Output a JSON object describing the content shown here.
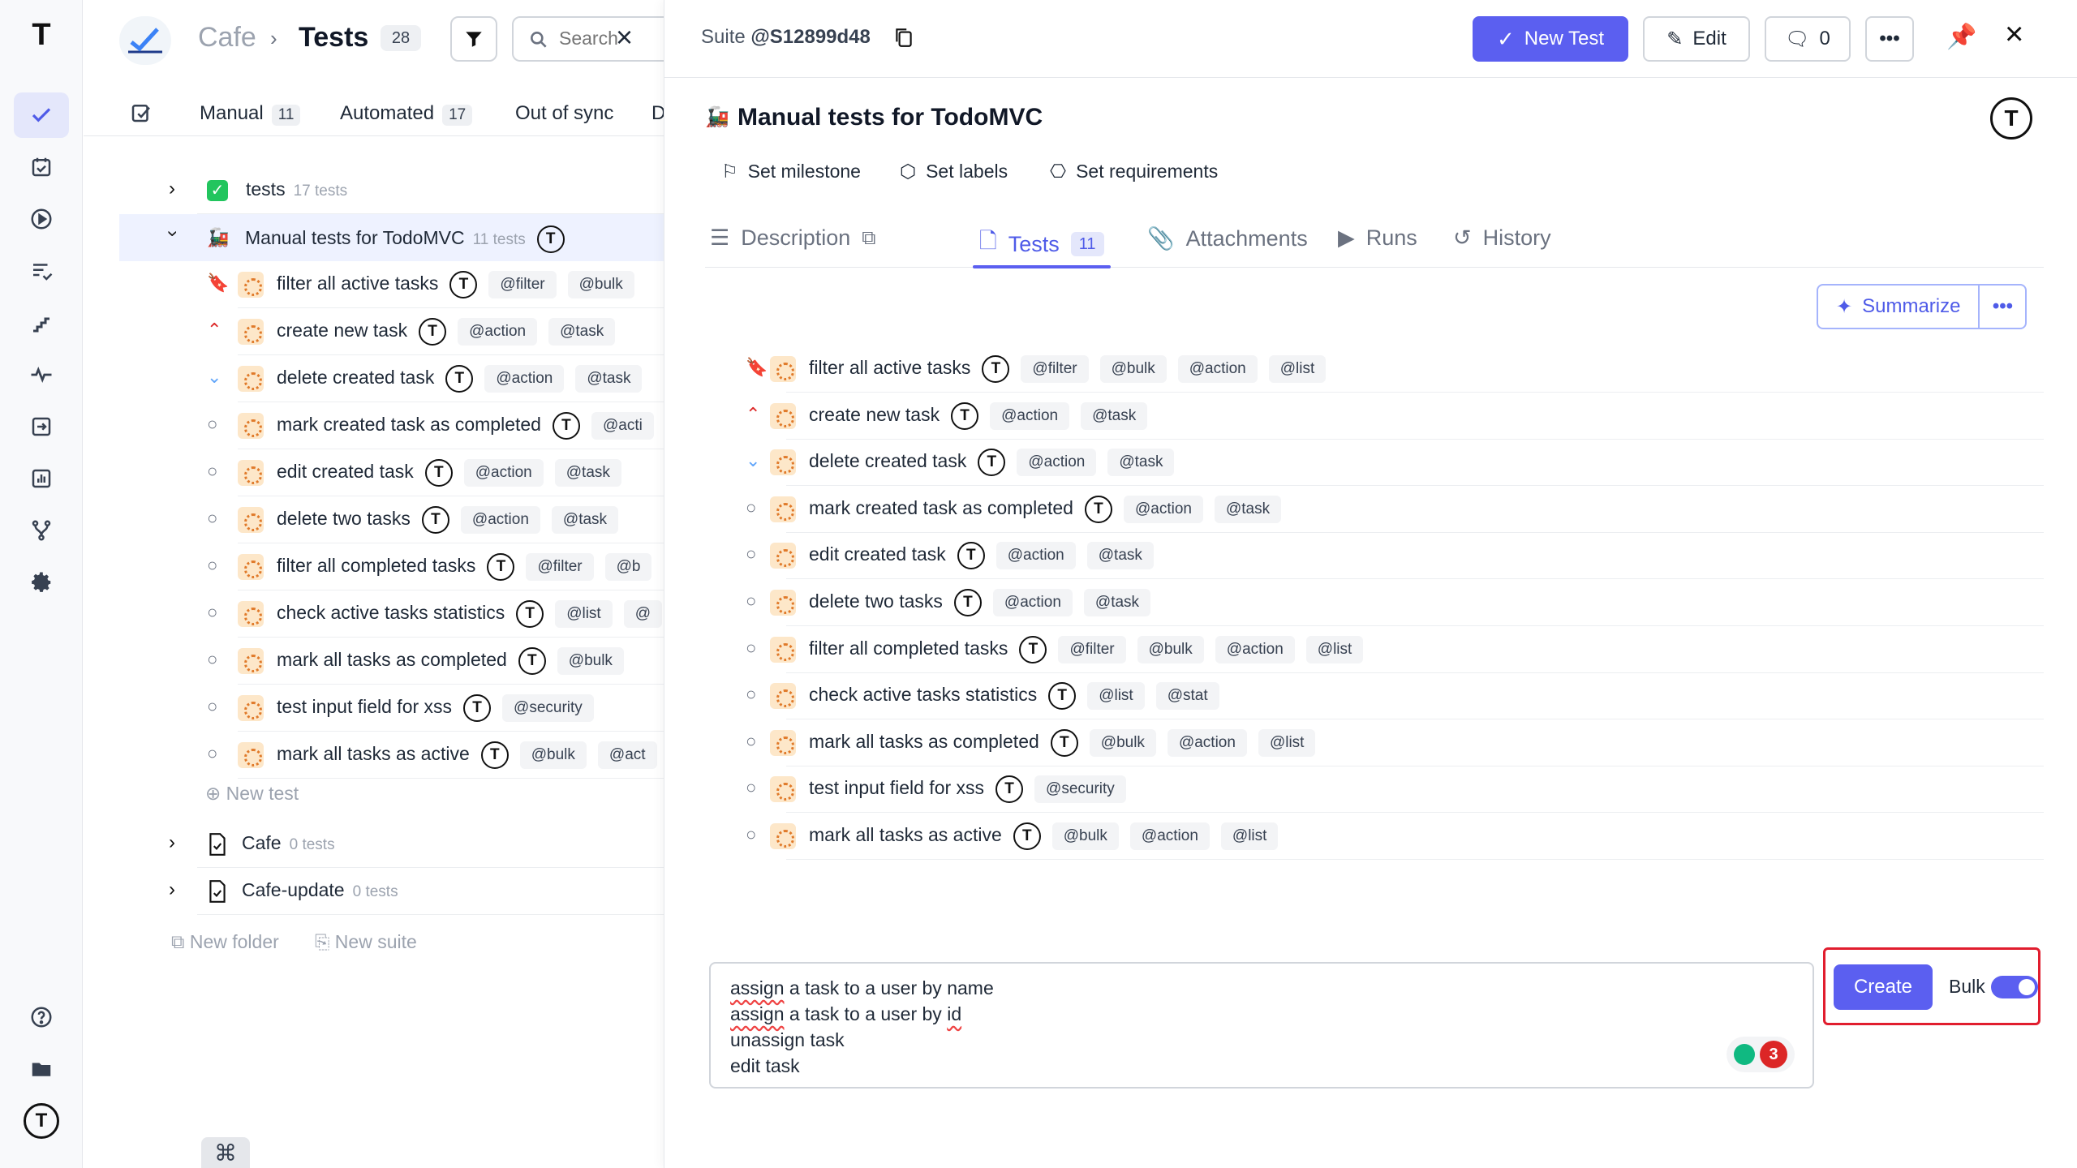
{
  "nav": {
    "logo": "T",
    "items": [
      "checklist",
      "tasks",
      "runs",
      "list-check",
      "steps",
      "pulse",
      "import",
      "analytics",
      "branches",
      "settings"
    ],
    "bottom": [
      "help",
      "folder",
      "profile"
    ]
  },
  "header": {
    "project": "Cafe",
    "separator": "›",
    "section": "Tests",
    "count": "28",
    "search_placeholder": "Search"
  },
  "filter_tabs": [
    {
      "label": "Manual",
      "count": "11"
    },
    {
      "label": "Automated",
      "count": "17"
    },
    {
      "label": "Out of sync",
      "count": ""
    },
    {
      "label": "D",
      "count": ""
    }
  ],
  "tree": {
    "suites_top": [
      {
        "label": "tests",
        "sub": "17 tests"
      },
      {
        "label": "Manual tests for TodoMVC",
        "sub": "11 tests"
      }
    ],
    "tests": [
      {
        "label": "filter all active tasks",
        "priority": "high",
        "tags": [
          "@filter",
          "@bulk"
        ]
      },
      {
        "label": "create new task",
        "priority": "up",
        "tags": [
          "@action",
          "@task"
        ]
      },
      {
        "label": "delete created task",
        "priority": "low",
        "tags": [
          "@action",
          "@task"
        ]
      },
      {
        "label": "mark created task as completed",
        "priority": "normal",
        "tags": [
          "@acti"
        ]
      },
      {
        "label": "edit created task",
        "priority": "normal",
        "tags": [
          "@action",
          "@task"
        ]
      },
      {
        "label": "delete two tasks",
        "priority": "normal",
        "tags": [
          "@action",
          "@task"
        ]
      },
      {
        "label": "filter all completed tasks",
        "priority": "normal",
        "tags": [
          "@filter",
          "@b"
        ]
      },
      {
        "label": "check active tasks statistics",
        "priority": "normal",
        "tags": [
          "@list",
          "@"
        ]
      },
      {
        "label": "mark all tasks as completed",
        "priority": "normal",
        "tags": [
          "@bulk",
          ""
        ]
      },
      {
        "label": "test input field for xss",
        "priority": "normal",
        "tags": [
          "@security"
        ]
      },
      {
        "label": "mark all tasks as active",
        "priority": "normal",
        "tags": [
          "@bulk",
          "@act"
        ]
      }
    ],
    "new_test": "New test",
    "suites_bottom": [
      {
        "label": "Cafe",
        "sub": "0 tests"
      },
      {
        "label": "Cafe-update",
        "sub": "0 tests"
      }
    ],
    "new_folder": "New folder",
    "new_suite": "New suite"
  },
  "detail": {
    "suite_prefix": "Suite",
    "suite_id": "@S12899d48",
    "new_test_btn": "New Test",
    "edit_btn": "Edit",
    "comments_count": "0",
    "title": "Manual tests for TodoMVC",
    "meta": [
      "Set milestone",
      "Set labels",
      "Set requirements"
    ],
    "tabs": [
      {
        "label": "Description"
      },
      {
        "label": "Tests",
        "count": "11"
      },
      {
        "label": "Attachments"
      },
      {
        "label": "Runs"
      },
      {
        "label": "History"
      }
    ],
    "summarize": "Summarize",
    "tests": [
      {
        "label": "filter all active tasks",
        "tags": [
          "@filter",
          "@bulk",
          "@action",
          "@list"
        ]
      },
      {
        "label": "create new task",
        "tags": [
          "@action",
          "@task"
        ]
      },
      {
        "label": "delete created task",
        "tags": [
          "@action",
          "@task"
        ]
      },
      {
        "label": "mark created task as completed",
        "tags": [
          "@action",
          "@task"
        ]
      },
      {
        "label": "edit created task",
        "tags": [
          "@action",
          "@task"
        ]
      },
      {
        "label": "delete two tasks",
        "tags": [
          "@action",
          "@task"
        ]
      },
      {
        "label": "filter all completed tasks",
        "tags": [
          "@filter",
          "@bulk",
          "@action",
          "@list"
        ]
      },
      {
        "label": "check active tasks statistics",
        "tags": [
          "@list",
          "@stat"
        ]
      },
      {
        "label": "mark all tasks as completed",
        "tags": [
          "@bulk",
          "@action",
          "@list"
        ]
      },
      {
        "label": "test input field for xss",
        "tags": [
          "@security"
        ]
      },
      {
        "label": "mark all tasks as active",
        "tags": [
          "@bulk",
          "@action",
          "@list"
        ]
      }
    ],
    "composer_lines": [
      {
        "pre": "",
        "sq": "assign",
        "post": " a task to a user by name"
      },
      {
        "pre": "",
        "sq": "assign",
        "post": " a task to a user by "
      },
      {
        "pre": "unassign task",
        "sq": "",
        "post": ""
      },
      {
        "pre": "edit task",
        "sq": "",
        "post": ""
      }
    ],
    "composer_line2_sq2": "id",
    "ai_count": "3",
    "create_btn": "Create",
    "bulk_label": "Bulk",
    "bulk_on": true
  },
  "cmd_key": "⌘",
  "colors": {
    "accent": "#5b5ff0",
    "danger": "#dc2626",
    "highlight": "#e11d2e"
  }
}
